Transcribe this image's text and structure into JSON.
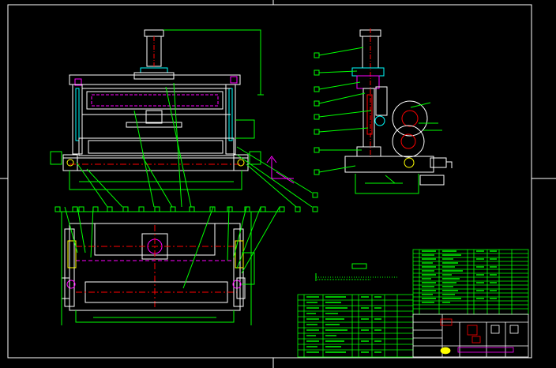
{
  "drawing": {
    "background": "#000000",
    "colors": {
      "frame": "#ffffff",
      "outline": "#ffffff",
      "dimension": "#00ff00",
      "leader": "#00ff00",
      "hidden": "#ff00ff",
      "centerline": "#ff0000",
      "cylinder": "#00ffff",
      "table": "#00ff00",
      "axis_marker": "#ff00ff",
      "accent": "#ffff00"
    },
    "views": [
      "front-view",
      "side-view",
      "top-view"
    ],
    "leader_balloon_count_top_row": 14,
    "leader_balloon_count_side": 8,
    "bom_rows_right": 16,
    "bom_rows_bottom": 11
  }
}
